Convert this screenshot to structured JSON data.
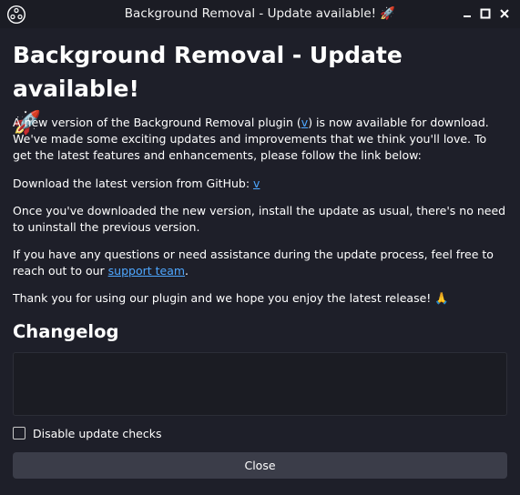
{
  "window": {
    "title": "Background Removal - Update available! 🚀"
  },
  "main": {
    "heading": "Background Removal - Update available!",
    "heading_emoji": "🚀",
    "intro_before_link": "A new version of the Background Removal plugin (",
    "intro_link": "v",
    "intro_after_link": ") is now available for download. We've made some exciting updates and improvements that we think you'll love. To get the latest features and enhancements, please follow the link below:",
    "download_text": "Download the latest version from GitHub: ",
    "download_link": "v",
    "install_text": "Once you've downloaded the new version, install the update as usual, there's no need to uninstall the previous version.",
    "help_before_link": "If you have any questions or need assistance during the update process, feel free to reach out to our ",
    "help_link": "support team",
    "help_after_link": ".",
    "thanks_text": "Thank you for using our plugin and we hope you enjoy the latest release! 🙏"
  },
  "changelog": {
    "title": "Changelog",
    "content": ""
  },
  "options": {
    "disable_checks_label": "Disable update checks",
    "disable_checks_checked": false
  },
  "footer": {
    "close_label": "Close"
  },
  "colors": {
    "background": "#1e1f29",
    "titlebar": "#1b1c24",
    "link": "#4ea7ff",
    "button": "#3b3d49"
  },
  "icons": {
    "app": "obs-logo-icon",
    "minimize": "minimize-icon",
    "maximize": "maximize-icon",
    "close": "close-icon"
  }
}
